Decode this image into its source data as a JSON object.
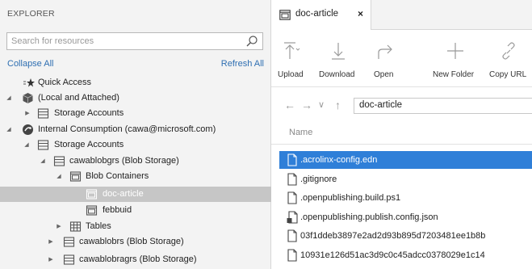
{
  "explorer": {
    "title": "EXPLORER",
    "search_placeholder": "Search for resources",
    "collapse_all": "Collapse All",
    "refresh_all": "Refresh All",
    "tree": [
      {
        "label": "Quick Access",
        "icon": "quick-access-icon",
        "toggle": ""
      },
      {
        "label": "(Local and Attached)",
        "icon": "local-box-icon",
        "toggle": "expanded"
      },
      {
        "label": "Storage Accounts",
        "icon": "storage-accounts-icon",
        "toggle": "collapsed"
      },
      {
        "label": "Internal Consumption (cawa@microsoft.com)",
        "icon": "subscription-icon",
        "toggle": "expanded"
      },
      {
        "label": "Storage Accounts",
        "icon": "storage-accounts-icon",
        "toggle": "expanded"
      },
      {
        "label": "cawablobgrs (Blob Storage)",
        "icon": "storage-account-icon",
        "toggle": "expanded"
      },
      {
        "label": "Blob Containers",
        "icon": "blob-containers-icon",
        "toggle": "expanded"
      },
      {
        "label": "doc-article",
        "icon": "container-icon",
        "toggle": "",
        "selected": true
      },
      {
        "label": "febbuid",
        "icon": "container-icon",
        "toggle": ""
      },
      {
        "label": "Tables",
        "icon": "tables-icon",
        "toggle": "collapsed"
      },
      {
        "label": "cawablobrs (Blob Storage)",
        "icon": "storage-account-icon",
        "toggle": "collapsed"
      },
      {
        "label": "cawablobragrs (Blob Storage)",
        "icon": "storage-account-icon",
        "toggle": "collapsed"
      }
    ]
  },
  "tab": {
    "label": "doc-article",
    "close": "×"
  },
  "toolbar": {
    "upload": "Upload",
    "download": "Download",
    "open": "Open",
    "new_folder": "New Folder",
    "copy_url": "Copy URL"
  },
  "address": {
    "path": "doc-article"
  },
  "list": {
    "column_name": "Name",
    "files": [
      {
        "name": ".acrolinx-config.edn",
        "icon": "file-icon",
        "selected": true
      },
      {
        "name": ".gitignore",
        "icon": "file-icon"
      },
      {
        "name": ".openpublishing.build.ps1",
        "icon": "file-icon"
      },
      {
        "name": ".openpublishing.publish.config.json",
        "icon": "json-file-icon"
      },
      {
        "name": "03f1ddeb3897e2ad2d93b895d7203481ee1b8b",
        "icon": "file-icon"
      },
      {
        "name": "10931e126d51ac3d9c0c45adcc0378029e1c14",
        "icon": "file-icon"
      }
    ]
  },
  "colors": {
    "accent": "#2f7fd8",
    "link": "#2f6fb2",
    "selected_tree": "#c6c6c6"
  }
}
